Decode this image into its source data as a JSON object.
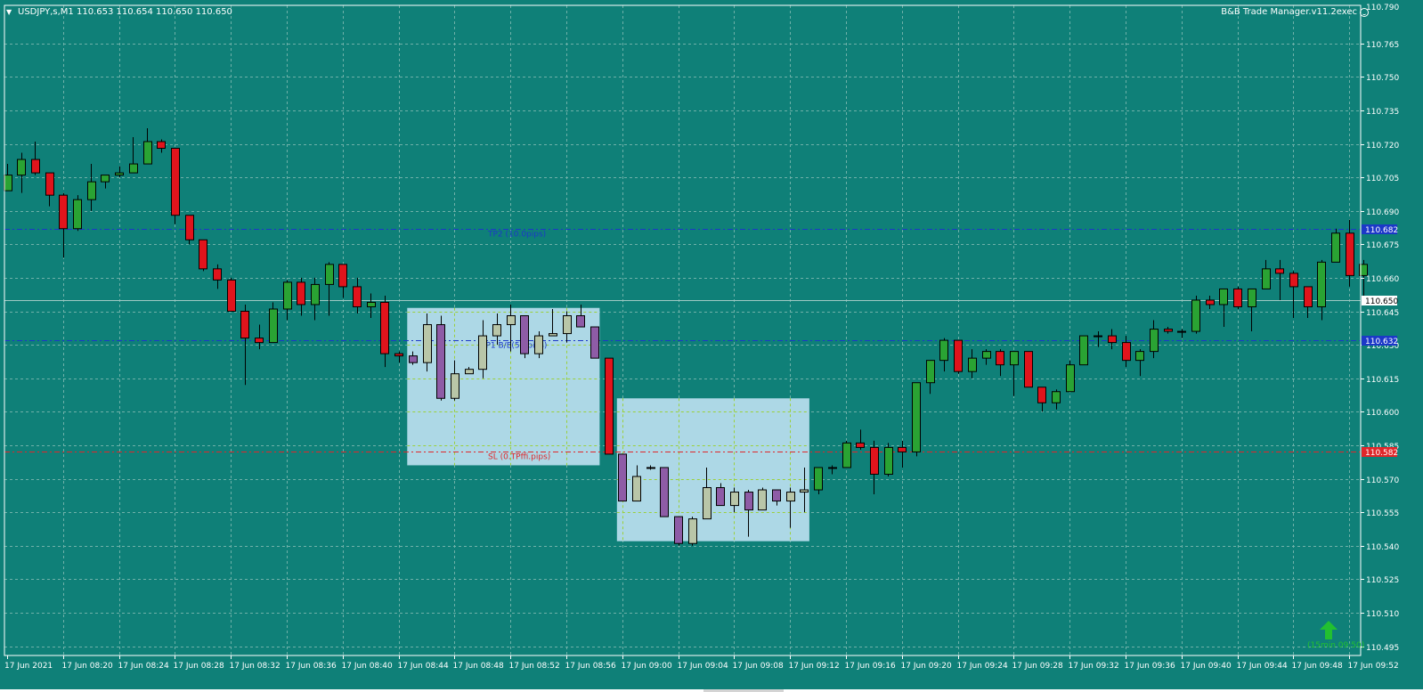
{
  "header": {
    "symbol_info": "USDJPY,s,M1  110.653 110.654 110.650 110.650",
    "ea_name": "B&B Trade Manager.v11.2exec"
  },
  "signal": {
    "label": "(15min 09:50)",
    "arrow": "up-arrow-icon"
  },
  "colors": {
    "background": "#0f8078",
    "grid": "#6fb1a9",
    "bull": "#2aa333",
    "bear": "#e0141c",
    "box_fill": "#add8e6",
    "box_bull": "#b9c6a8",
    "box_bear": "#8e5ca6",
    "tp_line": "#1c38c8",
    "sl_line": "#e0262a",
    "tag_text": "#ffffff"
  },
  "chart_data": {
    "type": "candlestick",
    "title": "",
    "xlabel": "",
    "ylabel": "",
    "ylim": [
      110.4875,
      110.7905
    ],
    "y_ticks": [
      "110.790",
      "110.765",
      "110.750",
      "110.735",
      "110.720",
      "110.705",
      "110.690",
      "110.675",
      "110.660",
      "110.645",
      "110.630",
      "110.615",
      "110.600",
      "110.585",
      "110.570",
      "110.555",
      "110.540",
      "110.525",
      "110.510",
      "110.495"
    ],
    "x_ticks": [
      "17 Jun 2021",
      "17 Jun 08:20",
      "17 Jun 08:24",
      "17 Jun 08:28",
      "17 Jun 08:32",
      "17 Jun 08:36",
      "17 Jun 08:40",
      "17 Jun 08:44",
      "17 Jun 08:48",
      "17 Jun 08:52",
      "17 Jun 08:56",
      "17 Jun 09:00",
      "17 Jun 09:04",
      "17 Jun 09:08",
      "17 Jun 09:12",
      "17 Jun 09:16",
      "17 Jun 09:20",
      "17 Jun 09:24",
      "17 Jun 09:28",
      "17 Jun 09:32",
      "17 Jun 09:36",
      "17 Jun 09:40",
      "17 Jun 09:44",
      "17 Jun 09:48",
      "17 Jun 09:52"
    ],
    "grid": true,
    "candles": [
      [
        110.699,
        110.711,
        110.702,
        110.706
      ],
      [
        110.706,
        110.716,
        110.698,
        110.713
      ],
      [
        110.713,
        110.721,
        110.706,
        110.707
      ],
      [
        110.707,
        110.707,
        110.692,
        110.697
      ],
      [
        110.697,
        110.698,
        110.669,
        110.682
      ],
      [
        110.682,
        110.697,
        110.681,
        110.695
      ],
      [
        110.695,
        110.711,
        110.69,
        110.703
      ],
      [
        110.703,
        110.706,
        110.7,
        110.706
      ],
      [
        110.706,
        110.71,
        110.705,
        110.707
      ],
      [
        110.707,
        110.723,
        110.707,
        110.711
      ],
      [
        110.711,
        110.727,
        110.711,
        110.721
      ],
      [
        110.721,
        110.722,
        110.716,
        110.718
      ],
      [
        110.718,
        110.718,
        110.684,
        110.688
      ],
      [
        110.688,
        110.688,
        110.675,
        110.677
      ],
      [
        110.677,
        110.677,
        110.663,
        110.664
      ],
      [
        110.664,
        110.666,
        110.655,
        110.659
      ],
      [
        110.659,
        110.66,
        110.645,
        110.645
      ],
      [
        110.645,
        110.648,
        110.612,
        110.633
      ],
      [
        110.633,
        110.639,
        110.628,
        110.631
      ],
      [
        110.631,
        110.649,
        110.631,
        110.646
      ],
      [
        110.646,
        110.659,
        110.641,
        110.658
      ],
      [
        110.658,
        110.66,
        110.643,
        110.648
      ],
      [
        110.648,
        110.66,
        110.641,
        110.657
      ],
      [
        110.657,
        110.667,
        110.643,
        110.666
      ],
      [
        110.666,
        110.666,
        110.651,
        110.656
      ],
      [
        110.656,
        110.66,
        110.644,
        110.647
      ],
      [
        110.647,
        110.653,
        110.642,
        110.649
      ],
      [
        110.649,
        110.652,
        110.62,
        110.626
      ],
      [
        110.626,
        110.627,
        110.622,
        110.625
      ],
      [
        110.625,
        110.627,
        110.621,
        110.622
      ],
      [
        110.622,
        110.644,
        110.618,
        110.639
      ],
      [
        110.639,
        110.643,
        110.605,
        110.606
      ],
      [
        110.606,
        110.623,
        110.605,
        110.617
      ],
      [
        110.617,
        110.62,
        110.617,
        110.619
      ],
      [
        110.619,
        110.641,
        110.615,
        110.634
      ],
      [
        110.634,
        110.644,
        110.63,
        110.639
      ],
      [
        110.639,
        110.648,
        110.627,
        110.643
      ],
      [
        110.643,
        110.643,
        110.624,
        110.626
      ],
      [
        110.626,
        110.636,
        110.624,
        110.634
      ],
      [
        110.634,
        110.646,
        110.634,
        110.635
      ],
      [
        110.635,
        110.645,
        110.631,
        110.643
      ],
      [
        110.643,
        110.648,
        110.638,
        110.638
      ],
      [
        110.638,
        110.638,
        110.624,
        110.624
      ],
      [
        110.624,
        110.624,
        110.581,
        110.581
      ],
      [
        110.581,
        110.581,
        110.56,
        110.56
      ],
      [
        110.56,
        110.576,
        110.571,
        110.571
      ],
      [
        110.575,
        110.576,
        110.574,
        110.575
      ],
      [
        110.575,
        110.575,
        110.553,
        110.553
      ],
      [
        110.553,
        110.553,
        110.54,
        110.541
      ],
      [
        110.541,
        110.553,
        110.54,
        110.552
      ],
      [
        110.552,
        110.575,
        110.552,
        110.566
      ],
      [
        110.566,
        110.568,
        110.558,
        110.558
      ],
      [
        110.558,
        110.566,
        110.555,
        110.564
      ],
      [
        110.564,
        110.565,
        110.544,
        110.556
      ],
      [
        110.556,
        110.566,
        110.556,
        110.565
      ],
      [
        110.565,
        110.565,
        110.558,
        110.56
      ],
      [
        110.56,
        110.566,
        110.548,
        110.564
      ],
      [
        110.564,
        110.575,
        110.555,
        110.565
      ],
      [
        110.565,
        110.575,
        110.563,
        110.575
      ],
      [
        110.575,
        110.576,
        110.572,
        110.575
      ],
      [
        110.575,
        110.587,
        110.575,
        110.586
      ],
      [
        110.586,
        110.592,
        110.583,
        110.584
      ],
      [
        110.584,
        110.587,
        110.563,
        110.572
      ],
      [
        110.572,
        110.586,
        110.571,
        110.584
      ],
      [
        110.584,
        110.587,
        110.575,
        110.582
      ],
      [
        110.582,
        110.613,
        110.58,
        110.613
      ],
      [
        110.613,
        110.623,
        110.608,
        110.623
      ],
      [
        110.623,
        110.633,
        110.618,
        110.632
      ],
      [
        110.632,
        110.632,
        110.617,
        110.618
      ],
      [
        110.618,
        110.628,
        110.615,
        110.624
      ],
      [
        110.624,
        110.628,
        110.621,
        110.627
      ],
      [
        110.627,
        110.628,
        110.616,
        110.621
      ],
      [
        110.621,
        110.625,
        110.607,
        110.627
      ],
      [
        110.627,
        110.627,
        110.611,
        110.611
      ],
      [
        110.611,
        110.611,
        110.6,
        110.604
      ],
      [
        110.604,
        110.61,
        110.601,
        110.609
      ],
      [
        110.609,
        110.623,
        110.609,
        110.621
      ],
      [
        110.621,
        110.634,
        110.621,
        110.634
      ],
      [
        110.634,
        110.636,
        110.629,
        110.634
      ],
      [
        110.634,
        110.637,
        110.628,
        110.631
      ],
      [
        110.631,
        110.634,
        110.62,
        110.623
      ],
      [
        110.623,
        110.628,
        110.616,
        110.627
      ],
      [
        110.627,
        110.641,
        110.624,
        110.637
      ],
      [
        110.637,
        110.638,
        110.635,
        110.636
      ],
      [
        110.636,
        110.637,
        110.633,
        110.636
      ],
      [
        110.636,
        110.652,
        110.635,
        110.65
      ],
      [
        110.65,
        110.652,
        110.646,
        110.648
      ],
      [
        110.648,
        110.654,
        110.638,
        110.655
      ],
      [
        110.655,
        110.656,
        110.646,
        110.647
      ],
      [
        110.647,
        110.65,
        110.636,
        110.655
      ],
      [
        110.655,
        110.668,
        110.655,
        110.664
      ],
      [
        110.664,
        110.668,
        110.65,
        110.662
      ],
      [
        110.662,
        110.663,
        110.642,
        110.656
      ],
      [
        110.656,
        110.656,
        110.642,
        110.647
      ],
      [
        110.647,
        110.668,
        110.641,
        110.667
      ],
      [
        110.667,
        110.682,
        110.667,
        110.68
      ],
      [
        110.68,
        110.686,
        110.656,
        110.661
      ],
      [
        110.661,
        110.668,
        110.652,
        110.666
      ]
    ],
    "levels": [
      {
        "name": "TP2",
        "label": "TP2 (10.0pips)",
        "price": 110.682,
        "tag": "110.682"
      },
      {
        "name": "TP1",
        "label": "TP1 B/E(5.0pips)",
        "price": 110.632,
        "tag": "110.632"
      },
      {
        "name": "SL",
        "label": "SL (0.TPffi.pips)",
        "price": 110.582,
        "tag": "110.582"
      }
    ],
    "current_price": {
      "price": 110.65,
      "tag": "110.650"
    },
    "session_boxes": [
      {
        "from": 29,
        "to": 42,
        "high": 110.6465,
        "low": 110.576
      },
      {
        "from": 44,
        "to": 57,
        "high": 110.606,
        "low": 110.542
      }
    ]
  }
}
